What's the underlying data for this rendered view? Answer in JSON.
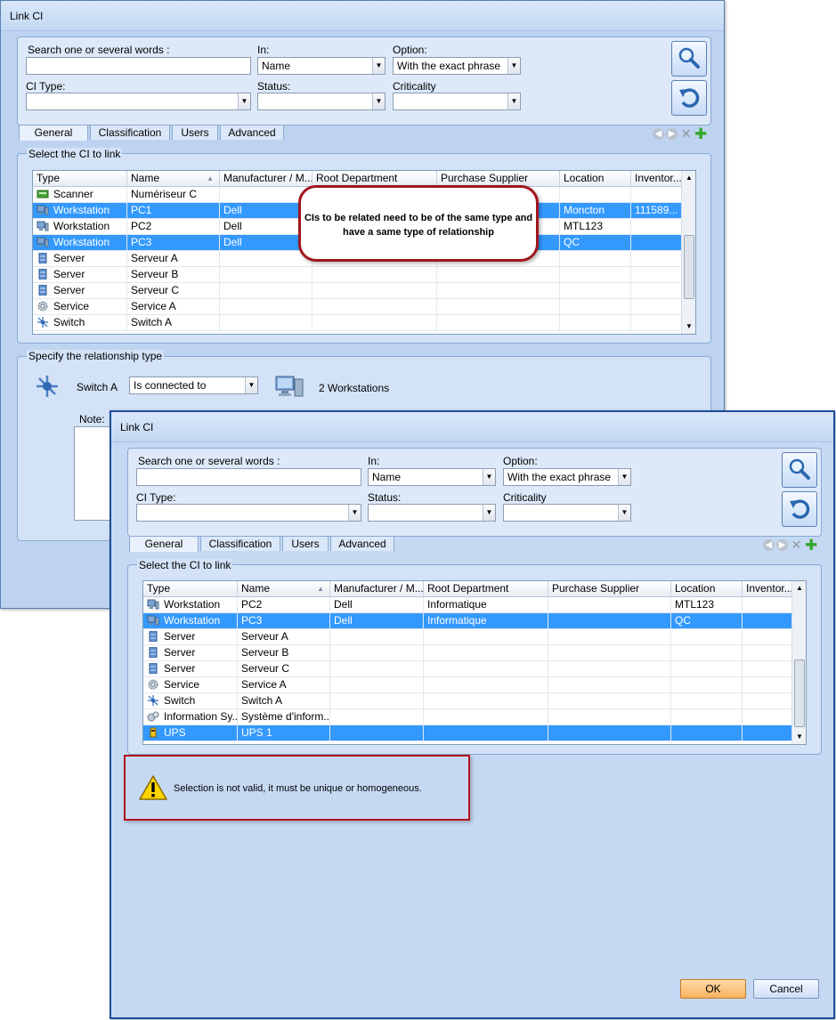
{
  "back_window": {
    "title": "Link CI",
    "search_label": "Search one or several words :",
    "in_label": "In:",
    "in_value": "Name",
    "option_label": "Option:",
    "option_value": "With the exact phrase",
    "ci_type_label": "CI Type:",
    "status_label": "Status:",
    "criticality_label": "Criticality",
    "tabs": [
      "General",
      "Classification",
      "Users",
      "Advanced"
    ],
    "select_group_label": "Select the CI to link",
    "columns": [
      "Type",
      "Name",
      "Manufacturer / M...",
      "Root Department",
      "Purchase Supplier",
      "Location",
      "Inventor..."
    ],
    "rows": [
      {
        "icon": "scanner-icon",
        "type": "Scanner",
        "name": "Numériseur C",
        "manufacturer": "",
        "location": "",
        "inventory": "",
        "selected": false
      },
      {
        "icon": "workstation-icon",
        "type": "Workstation",
        "name": "PC1",
        "manufacturer": "Dell",
        "location": "Moncton",
        "inventory": "111589...",
        "selected": true
      },
      {
        "icon": "workstation-icon",
        "type": "Workstation",
        "name": "PC2",
        "manufacturer": "Dell",
        "location": "MTL123",
        "inventory": "",
        "selected": false
      },
      {
        "icon": "workstation-icon",
        "type": "Workstation",
        "name": "PC3",
        "manufacturer": "Dell",
        "location": "QC",
        "inventory": "",
        "selected": true
      },
      {
        "icon": "server-icon",
        "type": "Server",
        "name": "Serveur A",
        "manufacturer": "",
        "location": "",
        "inventory": "",
        "selected": false
      },
      {
        "icon": "server-icon",
        "type": "Server",
        "name": "Serveur B",
        "manufacturer": "",
        "location": "",
        "inventory": "",
        "selected": false
      },
      {
        "icon": "server-icon",
        "type": "Server",
        "name": "Serveur C",
        "manufacturer": "",
        "location": "",
        "inventory": "",
        "selected": false
      },
      {
        "icon": "service-icon",
        "type": "Service",
        "name": "Service A",
        "manufacturer": "",
        "location": "",
        "inventory": "",
        "selected": false
      },
      {
        "icon": "switch-icon",
        "type": "Switch",
        "name": "Switch A",
        "manufacturer": "",
        "location": "",
        "inventory": "",
        "selected": false
      }
    ],
    "callout": "CIs to be related need to be of the same type and have a same type of relationship",
    "relationship_label": "Specify the relationship type",
    "source_name": "Switch A",
    "relationship_value": "Is connected to",
    "target_label": "2 Workstations",
    "note_label": "Note:"
  },
  "front_window": {
    "title": "Link CI",
    "search_label": "Search one or several words :",
    "in_label": "In:",
    "in_value": "Name",
    "option_label": "Option:",
    "option_value": "With the exact phrase",
    "ci_type_label": "CI Type:",
    "status_label": "Status:",
    "criticality_label": "Criticality",
    "tabs": [
      "General",
      "Classification",
      "Users",
      "Advanced"
    ],
    "select_group_label": "Select the CI to link",
    "columns": [
      "Type",
      "Name",
      "Manufacturer / M...",
      "Root Department",
      "Purchase Supplier",
      "Location",
      "Inventor..."
    ],
    "rows": [
      {
        "icon": "workstation-icon",
        "type": "Workstation",
        "name": "PC2",
        "manufacturer": "Dell",
        "department": "Informatique",
        "location": "MTL123",
        "selected": false
      },
      {
        "icon": "workstation-icon",
        "type": "Workstation",
        "name": "PC3",
        "manufacturer": "Dell",
        "department": "Informatique",
        "location": "QC",
        "selected": true
      },
      {
        "icon": "server-icon",
        "type": "Server",
        "name": "Serveur A",
        "manufacturer": "",
        "department": "",
        "location": "",
        "selected": false
      },
      {
        "icon": "server-icon",
        "type": "Server",
        "name": "Serveur B",
        "manufacturer": "",
        "department": "",
        "location": "",
        "selected": false
      },
      {
        "icon": "server-icon",
        "type": "Server",
        "name": "Serveur C",
        "manufacturer": "",
        "department": "",
        "location": "",
        "selected": false
      },
      {
        "icon": "service-icon",
        "type": "Service",
        "name": "Service A",
        "manufacturer": "",
        "department": "",
        "location": "",
        "selected": false
      },
      {
        "icon": "switch-icon",
        "type": "Switch",
        "name": "Switch A",
        "manufacturer": "",
        "department": "",
        "location": "",
        "selected": false
      },
      {
        "icon": "information-system-icon",
        "type": "Information Sy...",
        "name": "Système d'inform...",
        "manufacturer": "",
        "department": "",
        "location": "",
        "selected": false
      },
      {
        "icon": "ups-icon",
        "type": "UPS",
        "name": "UPS 1",
        "manufacturer": "",
        "department": "",
        "location": "",
        "selected": true
      }
    ],
    "warning": "Selection is not valid, it must be unique or homogeneous.",
    "ok_label": "OK",
    "cancel_label": "Cancel"
  },
  "colors": {
    "selection": "#3399ff",
    "window_bg": "#c6d9f3",
    "callout_border": "#a0161c",
    "ok_button": "#f7b35f"
  }
}
